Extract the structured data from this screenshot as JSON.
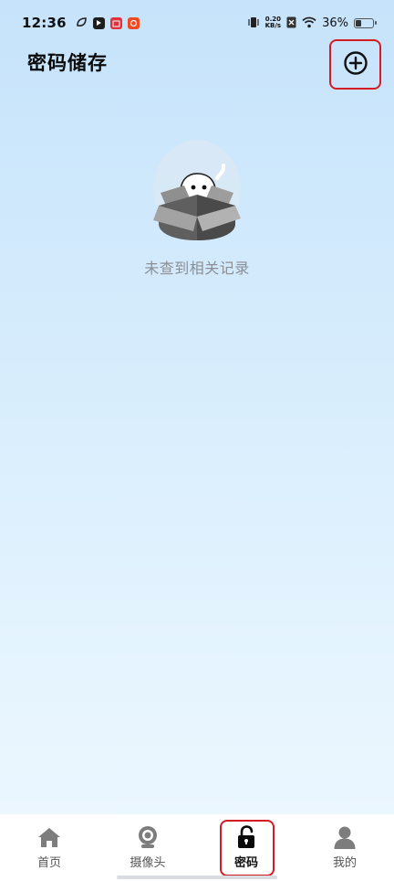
{
  "status_bar": {
    "time": "12:36",
    "net_speed_value": "0.20",
    "net_speed_unit": "KB/s",
    "battery_percent": "36%",
    "battery_level": 0.36
  },
  "header": {
    "title": "密码储存"
  },
  "empty_state": {
    "message": "未查到相关记录"
  },
  "bottom_nav": {
    "items": [
      {
        "label": "首页",
        "icon": "home-icon"
      },
      {
        "label": "摄像头",
        "icon": "camera-icon"
      },
      {
        "label": "密码",
        "icon": "unlock-icon",
        "active": true
      },
      {
        "label": "我的",
        "icon": "user-icon"
      }
    ]
  },
  "colors": {
    "accent_red": "#d51c24",
    "gradient_top": "#c6e3fb",
    "gradient_bottom": "#eef8ff"
  }
}
